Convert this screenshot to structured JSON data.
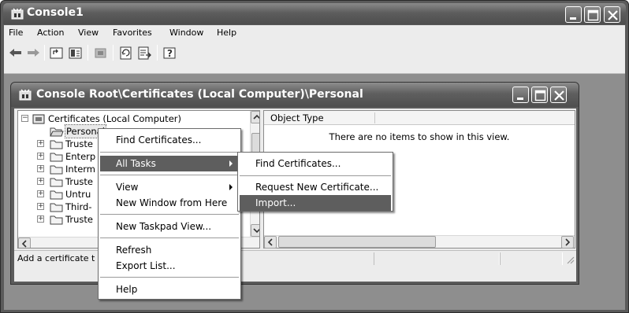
{
  "window": {
    "title": "Console1"
  },
  "menubar": {
    "items": [
      "File",
      "Action",
      "View",
      "Favorites",
      "Window",
      "Help"
    ]
  },
  "child_window": {
    "title": "Console Root\\Certificates (Local Computer)\\Personal"
  },
  "tree": {
    "root_label": "Certificates (Local Computer)",
    "items": [
      "Personal",
      "Truste",
      "Enterp",
      "Interm",
      "Truste",
      "Untru",
      "Third-",
      "Truste"
    ]
  },
  "list": {
    "column_header": "Object Type",
    "empty_message": "There are no items to show in this view."
  },
  "statusbar": {
    "text": "Add a certificate t"
  },
  "context_menu": {
    "find_certificates": "Find Certificates...",
    "all_tasks": "All Tasks",
    "view": "View",
    "new_window_from_here": "New Window from Here",
    "new_taskpad_view": "New Taskpad View...",
    "refresh": "Refresh",
    "export_list": "Export List...",
    "help": "Help"
  },
  "submenu": {
    "find_certificates": "Find Certificates...",
    "request_new_certificate": "Request New Certificate...",
    "import": "Import..."
  },
  "colors": {
    "highlight": "#5e5e5e",
    "titlebar": "#5d5d5d"
  }
}
